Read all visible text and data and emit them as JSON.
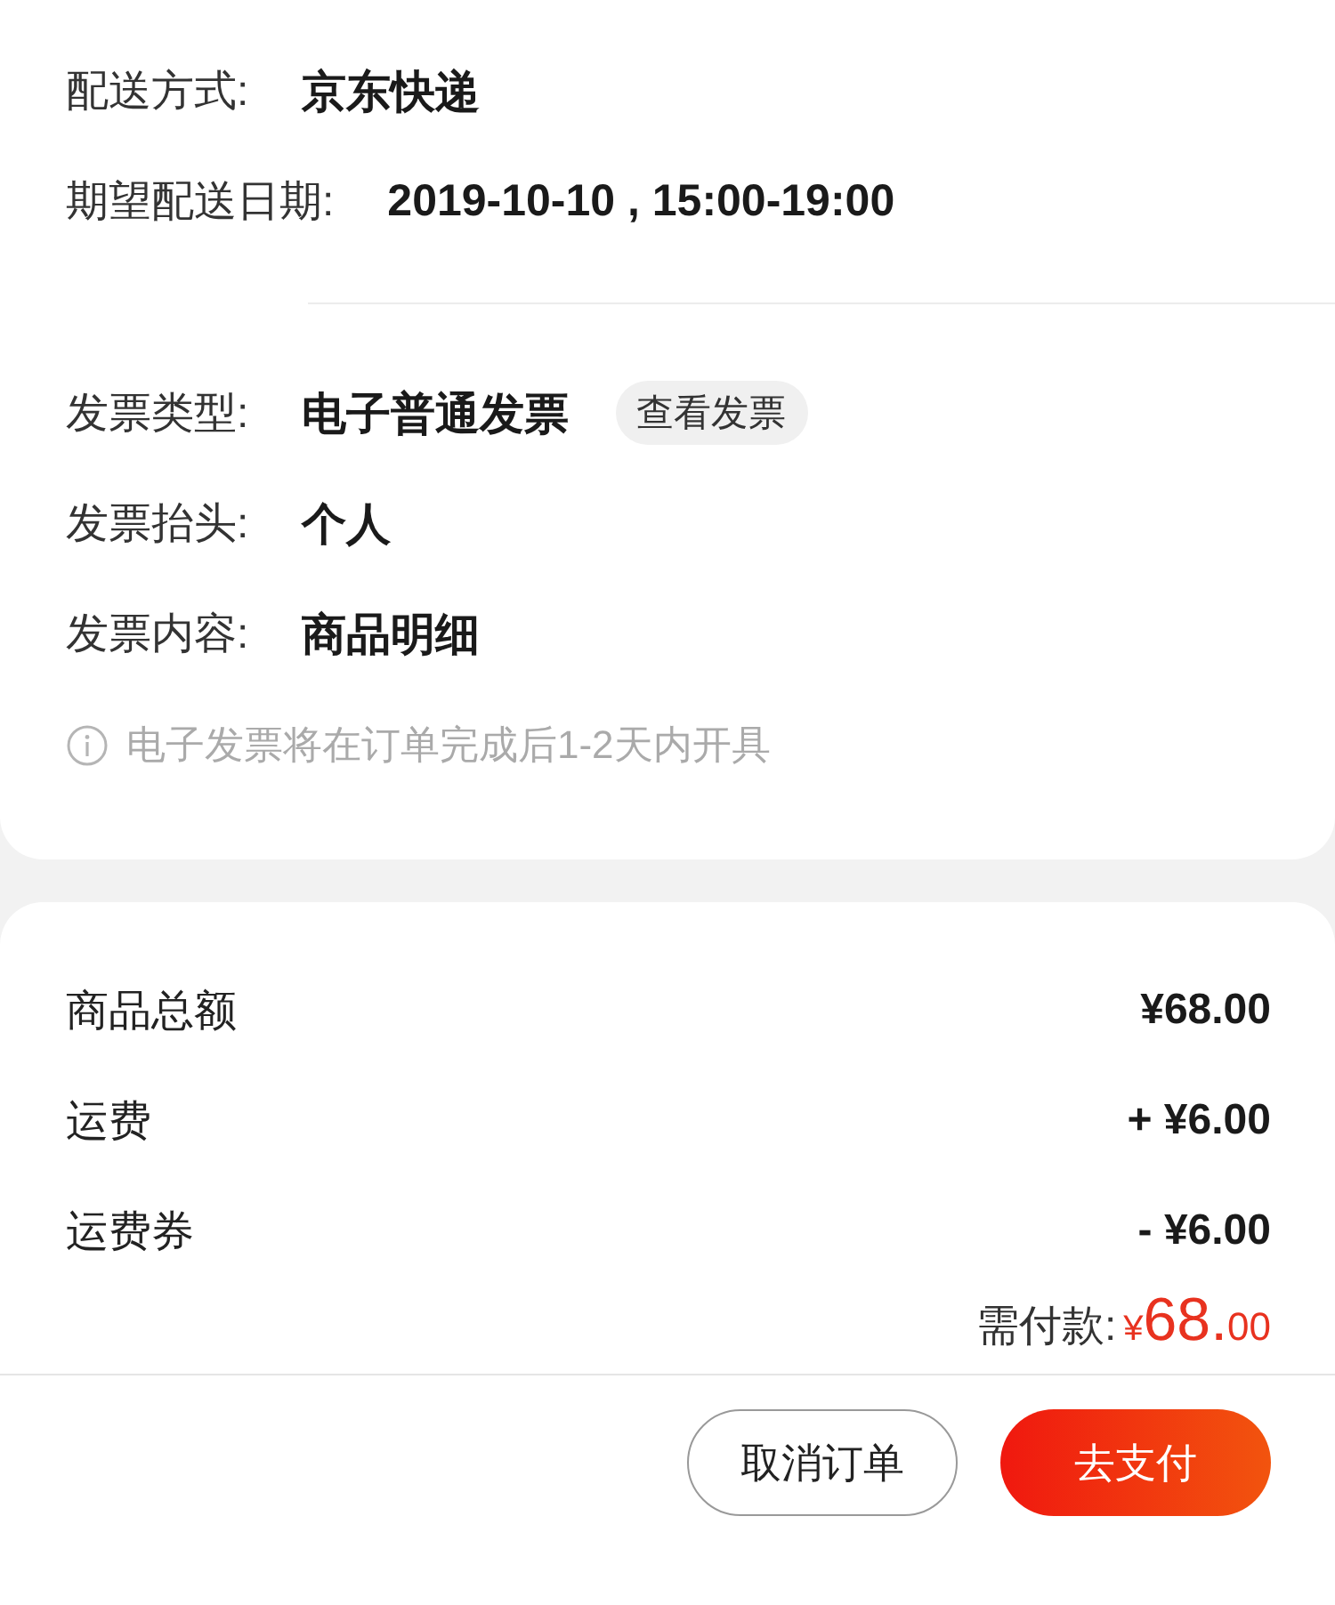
{
  "delivery": [
    {
      "label": "配送方式:",
      "value": "京东快递"
    },
    {
      "label": "期望配送日期:",
      "value": "2019-10-10 , 15:00-19:00"
    }
  ],
  "invoice": {
    "rows": [
      {
        "label": "发票类型:",
        "value": "电子普通发票",
        "action": "查看发票"
      },
      {
        "label": "发票抬头:",
        "value": "个人"
      },
      {
        "label": "发票内容:",
        "value": "商品明细"
      }
    ],
    "note": "电子发票将在订单完成后1-2天内开具"
  },
  "summary": {
    "rows": [
      {
        "label": "商品总额",
        "value": "¥68.00"
      },
      {
        "label": "运费",
        "value": "+ ¥6.00"
      },
      {
        "label": "运费券",
        "value": "- ¥6.00"
      }
    ],
    "total_label": "需付款:",
    "total_currency": "¥",
    "total_main": "68.",
    "total_fraction": "00"
  },
  "buttons": {
    "cancel": "取消订单",
    "pay": "去支付"
  }
}
